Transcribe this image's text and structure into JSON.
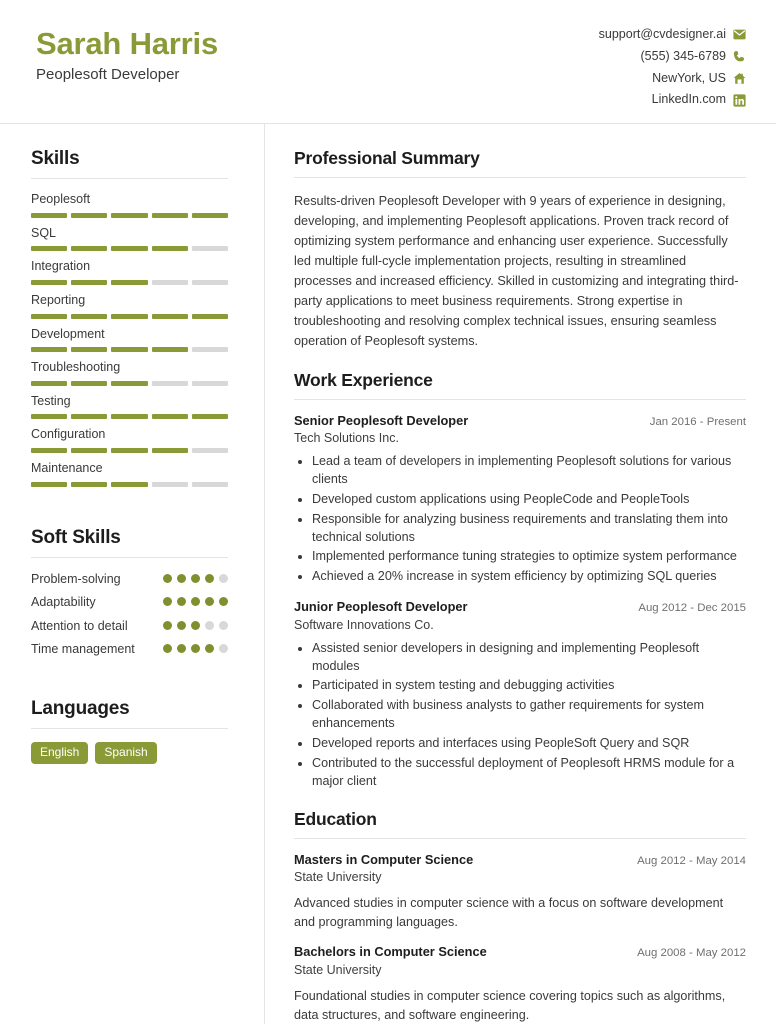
{
  "header": {
    "name": "Sarah Harris",
    "role": "Peoplesoft Developer",
    "contacts": [
      {
        "text": "support@cvdesigner.ai",
        "icon": "envelope-icon"
      },
      {
        "text": "(555) 345-6789",
        "icon": "phone-icon"
      },
      {
        "text": "NewYork, US",
        "icon": "home-icon"
      },
      {
        "text": "LinkedIn.com",
        "icon": "linkedin-icon"
      }
    ]
  },
  "colors": {
    "accent": "#8a9a36",
    "dot_on": "#7f912f",
    "track": "#d8d8d8",
    "rule": "#e4e4e4"
  },
  "sidebar": {
    "skills": {
      "title": "Skills",
      "max": 5,
      "items": [
        {
          "label": "Peoplesoft",
          "level": 5
        },
        {
          "label": "SQL",
          "level": 4
        },
        {
          "label": "Integration",
          "level": 3
        },
        {
          "label": "Reporting",
          "level": 5
        },
        {
          "label": "Development",
          "level": 4
        },
        {
          "label": "Troubleshooting",
          "level": 3
        },
        {
          "label": "Testing",
          "level": 5
        },
        {
          "label": "Configuration",
          "level": 4
        },
        {
          "label": "Maintenance",
          "level": 3
        }
      ]
    },
    "soft_skills": {
      "title": "Soft Skills",
      "max": 5,
      "items": [
        {
          "label": "Problem-solving",
          "level": 4
        },
        {
          "label": "Adaptability",
          "level": 5
        },
        {
          "label": "Attention to detail",
          "level": 3
        },
        {
          "label": "Time management",
          "level": 4
        }
      ]
    },
    "languages": {
      "title": "Languages",
      "items": [
        "English",
        "Spanish"
      ]
    }
  },
  "main": {
    "summary": {
      "title": "Professional Summary",
      "text": "Results-driven Peoplesoft Developer with 9 years of experience in designing, developing, and implementing Peoplesoft applications. Proven track record of optimizing system performance and enhancing user experience. Successfully led multiple full-cycle implementation projects, resulting in streamlined processes and increased efficiency. Skilled in customizing and integrating third-party applications to meet business requirements. Strong expertise in troubleshooting and resolving complex technical issues, ensuring seamless operation of Peoplesoft systems."
    },
    "experience": {
      "title": "Work Experience",
      "entries": [
        {
          "title": "Senior Peoplesoft Developer",
          "date": "Jan 2016 - Present",
          "company": "Tech Solutions Inc.",
          "bullets": [
            "Lead a team of developers in implementing Peoplesoft solutions for various clients",
            "Developed custom applications using PeopleCode and PeopleTools",
            "Responsible for analyzing business requirements and translating them into technical solutions",
            "Implemented performance tuning strategies to optimize system performance",
            "Achieved a 20% increase in system efficiency by optimizing SQL queries"
          ]
        },
        {
          "title": "Junior Peoplesoft Developer",
          "date": "Aug 2012 - Dec 2015",
          "company": "Software Innovations Co.",
          "bullets": [
            "Assisted senior developers in designing and implementing Peoplesoft modules",
            "Participated in system testing and debugging activities",
            "Collaborated with business analysts to gather requirements for system enhancements",
            "Developed reports and interfaces using PeopleSoft Query and SQR",
            "Contributed to the successful deployment of Peoplesoft HRMS module for a major client"
          ]
        }
      ]
    },
    "education": {
      "title": "Education",
      "entries": [
        {
          "title": "Masters in Computer Science",
          "date": "Aug 2012 - May 2014",
          "school": "State University",
          "desc": "Advanced studies in computer science with a focus on software development and programming languages."
        },
        {
          "title": "Bachelors in Computer Science",
          "date": "Aug 2008 - May 2012",
          "school": "State University",
          "desc": "Foundational studies in computer science covering topics such as algorithms, data structures, and software engineering."
        }
      ]
    }
  }
}
